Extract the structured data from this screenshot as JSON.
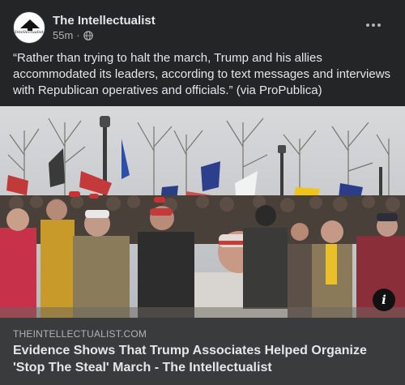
{
  "post": {
    "page_name": "The Intellectualist",
    "avatar_text": "Intellectualist",
    "time": "55m",
    "separator": "·",
    "audience_icon": "globe-icon",
    "more_icon": "more-horizontal-icon",
    "text": "“Rather than trying to halt the march, Trump and his allies accommodated its leaders, according to text messages and interviews with Republican operatives and officials.” (via ProPublica)"
  },
  "link": {
    "domain": "THEINTELLECTUALIST.COM",
    "title": "Evidence Shows That Trump Associates Helped Organize 'Stop The Steal' March - The Intellectualist",
    "info_icon": "info-icon",
    "info_glyph": "i"
  },
  "colors": {
    "card_bg": "#242526",
    "link_bg": "#3a3b3c",
    "primary_text": "#e4e6eb",
    "secondary_text": "#b0b3b8"
  }
}
